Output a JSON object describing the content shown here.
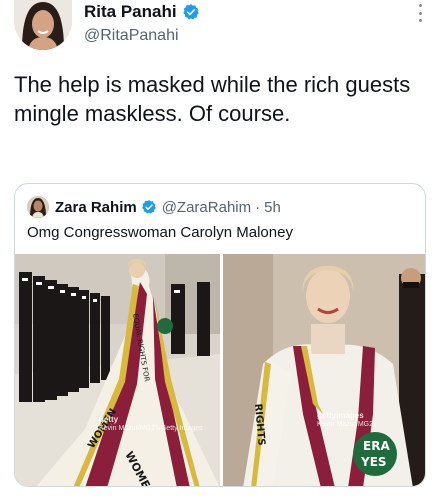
{
  "tweet": {
    "author_name": "Rita Panahi",
    "author_handle": "@RitaPanahi",
    "text": "The help is masked while the rich guests mingle maskless. Of course."
  },
  "quoted": {
    "author_name": "Zara Rahim",
    "author_handle": "@ZaraRahim",
    "separator": "·",
    "time": "5h",
    "text": "Omg Congresswoman Carolyn Maloney"
  },
  "photos": [
    {
      "watermark_brand": "getty",
      "watermark_line": "Kevin Mazur/MG21/Getty Images"
    },
    {
      "watermark_brand": "gettyimages",
      "watermark_line": "Kevin Mazur/MG21"
    }
  ],
  "icons": {
    "verified": "verified-badge-icon",
    "more": "more-options-icon"
  },
  "colors": {
    "verified": "#1d9bf0",
    "text": "#0f1419",
    "secondary": "#536471",
    "border": "#cfd9de"
  }
}
